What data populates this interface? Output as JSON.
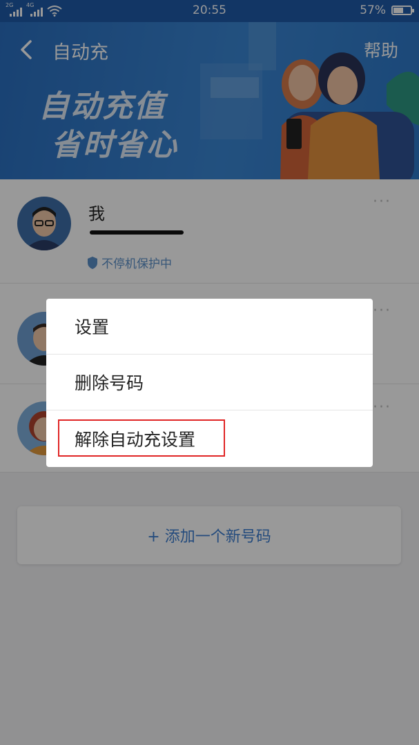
{
  "status_bar": {
    "signal1_tag": "2G",
    "signal2_tag": "4G",
    "time": "20:55",
    "battery_pct": "57%",
    "battery_level": 0.57
  },
  "header": {
    "title": "自动充",
    "help": "帮助",
    "back_icon": "chevron-left-icon"
  },
  "banner": {
    "slogan_line1": "自动充值",
    "slogan_line2": "省时省心"
  },
  "accounts": [
    {
      "name": "我",
      "badge": "不停机保护中",
      "more": "···"
    },
    {
      "more": "···"
    },
    {
      "more": "···"
    }
  ],
  "add_number": "+ 添加一个新号码",
  "menu": {
    "items": [
      "设置",
      "删除号码",
      "解除自动充设置"
    ]
  },
  "colors": {
    "brand_blue": "#2a6fc0",
    "highlight_red": "#e02424",
    "link_blue": "#3d7ed0"
  }
}
